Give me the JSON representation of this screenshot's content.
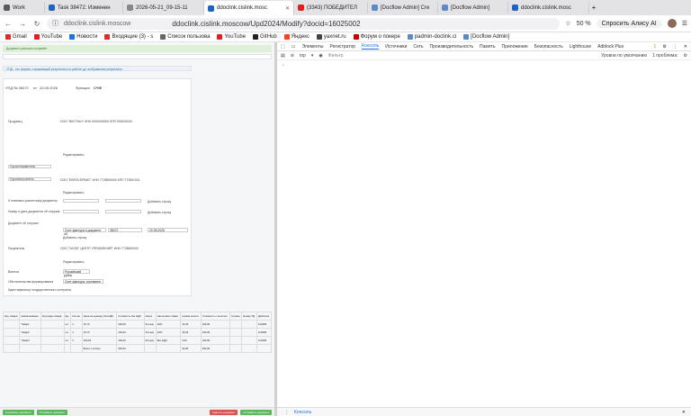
{
  "tabs": [
    {
      "label": "Work",
      "favicon": "#5a5a5a"
    },
    {
      "label": "Task 38472: Изменен",
      "favicon": "#1b64c4"
    },
    {
      "label": "2026-05-21_09-15-11",
      "favicon": "#888888"
    },
    {
      "label": "ddoclink.cislink.mosc",
      "favicon": "#1b64c4"
    },
    {
      "label": "(3343) ПОБЕДИТЕЛ",
      "favicon": "#e02020"
    },
    {
      "label": "[Docflow Admin] Cre",
      "favicon": "#5a8ac8"
    },
    {
      "label": "[Docflow Admin]",
      "favicon": "#5a8ac8"
    },
    {
      "label": "ddoclink.cislink.mosc",
      "favicon": "#1b64c4"
    }
  ],
  "address": {
    "site": "ddoclink.cislink.moscow",
    "title": "ddoclink.cislink.moscow/Upd2024/Modify?docid=16025002",
    "zoom": "50 %",
    "alice": "Спросить Алису AI"
  },
  "bookmarks": [
    "Gmail",
    "YouTube",
    "Новости",
    "Входящие (3) - s",
    "Список пользова",
    "YouTube",
    "GitHub",
    "Яндекс",
    "yaxnet.ru",
    "Форум о покере",
    "padmin-doclink.ci",
    "[Docflow Admin]"
  ],
  "page": {
    "success": "Документ успешно сохранён",
    "notice": "УПД - это форма, отражающий результаты по работе до отображения результата.",
    "doc_label": "УПД № 38472",
    "doc_date_label": "от",
    "doc_date": "20.05.2026",
    "func_label": "Функция",
    "func_value": "СЧФ",
    "sections": [
      "Продавец",
      "Грузоотправитель",
      "Грузополучатель",
      "К платежно-расчетному документу",
      "Номер и дата документа об отгрузке",
      "Документ об отгрузке",
      "Покупатель",
      "Валюта",
      "Обстоятельства формирования",
      "Идентификатор государственного контракта",
      "Подписи"
    ],
    "seller": "ООО \"ВКЛ Рент\" ИНН 0000000000 КПП 000000000",
    "consignee": "ООО \"ЕВРОСЕРВИС\" ИНН 7728500000 КПП 772801001",
    "buyer": "ООО \"ЗАЛОГ ЦЕНТР УПРАВЛЕНИЯ\" ИНН 7728500000",
    "edit": "Редактировать",
    "add": "Добавить строку",
    "currency": "Российский рубль",
    "circumstance": "Счет-фактура, составлен",
    "shipment": "Счет-фактура и документ об",
    "ship_no": "38472",
    "ship_date": "20.05.2026"
  },
  "table": {
    "headers": [
      "Код товара",
      "Наименование",
      "Код вида товара",
      "Ед.",
      "Кол-во",
      "Цена за единицу без НДС",
      "Стоимость без НДС",
      "Акциз",
      "Налоговая ставка",
      "Сумма налога",
      "Стоимость с налогом",
      "Страна",
      "Номер ТД",
      "Действия"
    ],
    "rows": [
      [
        "",
        "Товар1",
        "",
        "шт",
        "1",
        "16,73",
        "100,00",
        "без акц",
        "20%",
        "16,33",
        "100,00",
        "",
        "",
        "123456"
      ],
      [
        "",
        "Товар2",
        "",
        "шт",
        "1",
        "16,73",
        "100,00",
        "без акц",
        "20%",
        "16,33",
        "100,00",
        "",
        "",
        "123456"
      ],
      [
        "",
        "Товар3",
        "",
        "шт",
        "1",
        "100,00",
        "100,00",
        "без акц",
        "Без НДС",
        "0,00",
        "100,00",
        "",
        "",
        "123456"
      ]
    ],
    "total_label": "Всего к оплате",
    "total_net": "300,00",
    "total_tax": "32,66",
    "total_gross": "300,00"
  },
  "footer": [
    "Сохранить документ",
    "Отправить документ",
    "Удалить документ",
    "Отправить документ"
  ],
  "devtools": {
    "tabs": [
      "Элементы",
      "Регистратор",
      "Консоль",
      "Источники",
      "Сеть",
      "Производительность",
      "Память",
      "Приложение",
      "Безопасность",
      "Lighthouse",
      "Adblock Plus"
    ],
    "active": "Консоль",
    "context": "top",
    "filter": "Фильтр",
    "levels": "Уровни по умолчанию",
    "issues": "1 проблема:",
    "issues_count": "1",
    "bottom_tab": "Консоль"
  },
  "colors": {
    "accent": "#1a73e8",
    "success": "#3c763d",
    "green_btn": "#5cb85c",
    "red_btn": "#d9534f"
  }
}
